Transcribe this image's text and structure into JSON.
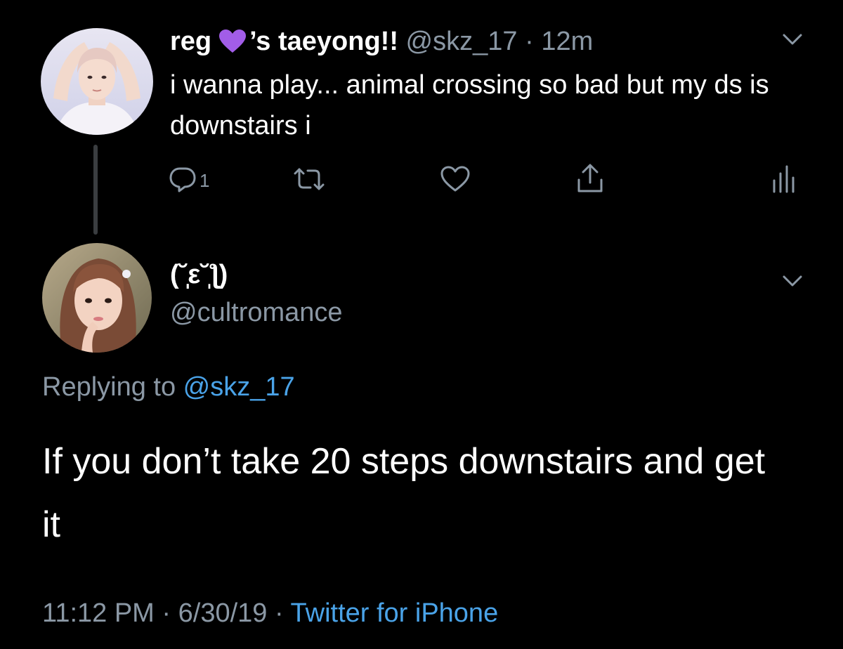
{
  "parent_tweet": {
    "display_name_prefix": "reg",
    "display_name_suffix": "’s taeyong!!",
    "name_emoji": "purple-heart",
    "handle": "@skz_17",
    "separator": " · ",
    "time_ago": "12m",
    "text": "i wanna play... animal crossing so bad but my ds is downstairs i",
    "reply_count": "1"
  },
  "reply_tweet": {
    "display_name": "(˘̩̩̩ε˘̩ƪ)",
    "handle": "@cultromance",
    "replying_prefix": "Replying to ",
    "replying_to": "@skz_17",
    "text": "If you don’t take 20 steps downstairs and get it",
    "time": "11:12 PM",
    "separator": " · ",
    "date": "6/30/19",
    "source": "Twitter for iPhone"
  },
  "colors": {
    "background": "#000000",
    "primary_text": "#ffffff",
    "secondary_text": "#8b98a5",
    "link": "#4aa3e8",
    "heart_emoji": "#a25de8",
    "thread_line": "#3a3d40"
  }
}
